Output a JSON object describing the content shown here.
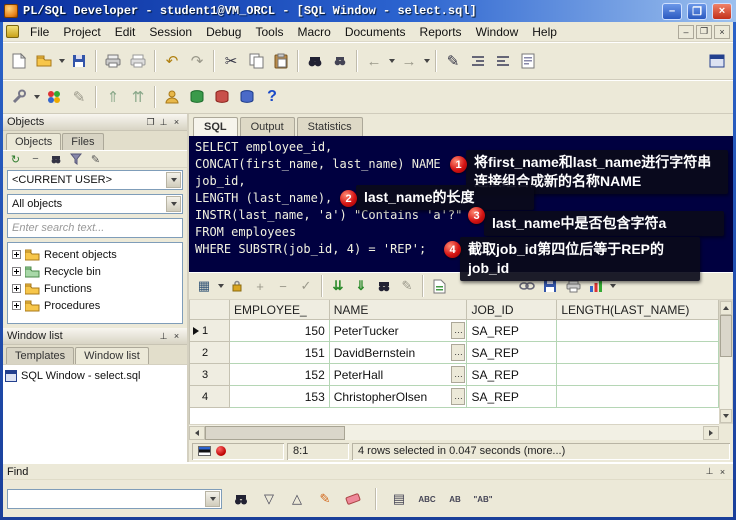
{
  "window": {
    "title": "PL/SQL Developer - student1@VM_ORCL - [SQL Window - select.sql]"
  },
  "menu": {
    "items": [
      "File",
      "Project",
      "Edit",
      "Session",
      "Debug",
      "Tools",
      "Macro",
      "Documents",
      "Reports",
      "Window",
      "Help"
    ]
  },
  "objects_panel": {
    "title": "Objects",
    "tabs": [
      "Objects",
      "Files"
    ],
    "schema": "<CURRENT USER>",
    "filter": "All objects",
    "search_placeholder": "Enter search text...",
    "tree": [
      "Recent objects",
      "Recycle bin",
      "Functions",
      "Procedures"
    ]
  },
  "window_list": {
    "title": "Window list",
    "tabs": [
      "Templates",
      "Window list"
    ],
    "items": [
      "SQL Window - select.sql"
    ]
  },
  "editor": {
    "tabs": [
      "SQL",
      "Output",
      "Statistics"
    ],
    "sql_lines": [
      "SELECT employee_id,",
      "CONCAT(first_name, last_name) NAME",
      "job_id,",
      "LENGTH (last_name),",
      "INSTR(last_name, 'a') \"Contains 'a'?\"",
      "FROM employees",
      "WHERE SUBSTR(job_id, 4) = 'REP';"
    ],
    "annotations": [
      {
        "num": "1",
        "text": "将first_name和last_name进行字符串连接组合成新的名称NAME"
      },
      {
        "num": "2",
        "text": "last_name的长度"
      },
      {
        "num": "3",
        "text": "last_name中是否包含字符a"
      },
      {
        "num": "4",
        "text": "截取job_id第四位后等于REP的job_id"
      }
    ]
  },
  "results": {
    "columns": [
      "EMPLOYEE_",
      "NAME",
      "JOB_ID",
      "LENGTH(LAST_NAME)"
    ],
    "rows": [
      {
        "num": "1",
        "employee_id": "150",
        "name": "PeterTucker",
        "job_id": "SA_REP",
        "length": ""
      },
      {
        "num": "2",
        "employee_id": "151",
        "name": "DavidBernstein",
        "job_id": "SA_REP",
        "length": ""
      },
      {
        "num": "3",
        "employee_id": "152",
        "name": "PeterHall",
        "job_id": "SA_REP",
        "length": ""
      },
      {
        "num": "4",
        "employee_id": "153",
        "name": "ChristopherOlsen",
        "job_id": "SA_REP",
        "length": ""
      }
    ]
  },
  "status": {
    "position": "8:1",
    "message": "4 rows selected in 0.047 seconds (more...)"
  },
  "find": {
    "title": "Find"
  },
  "icons": {
    "close": "×",
    "minimize": "–",
    "restore": "❐",
    "pin": "⊥",
    "undo": "↶",
    "redo": "↷",
    "cut": "✂",
    "back": "←",
    "forward": "→",
    "pencil": "✎",
    "help": "?",
    "refresh": "↻",
    "plus": "+",
    "minus": "−",
    "check": "✓",
    "compile": "⇑",
    "debug": "⇈",
    "fetch_next": "⇊",
    "fetch_all": "⇓",
    "grid": "▦",
    "find_down": "▽",
    "find_up": "△",
    "list": "▤",
    "whole_word": "ABC",
    "match_case": "AB",
    "quoted": "\"AB\"",
    "ellipsis": "…"
  },
  "colors": {
    "titlebar_start": "#0a2f9e",
    "titlebar_end": "#9cc0ee",
    "editor_bg": "#000040",
    "annotation_bg": "#0c0c20",
    "badge_red": "#cf1212",
    "chrome_tan": "#ece9d8",
    "grid_line_green": "#b5d6b5"
  }
}
